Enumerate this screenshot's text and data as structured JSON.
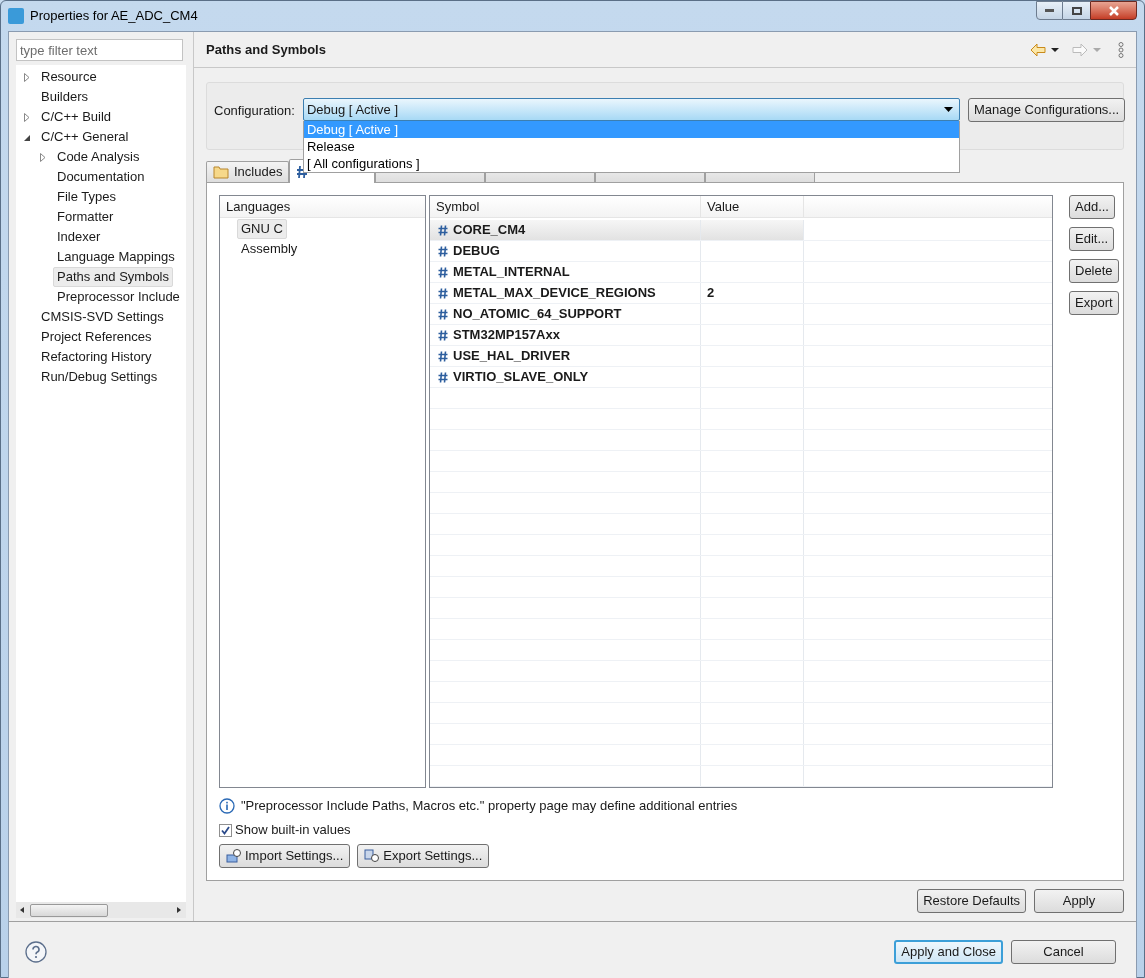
{
  "window": {
    "title": "Properties for AE_ADC_CM4"
  },
  "filter": {
    "placeholder": "type filter text"
  },
  "tree": [
    {
      "label": "Resource",
      "selected": false,
      "expanded": false
    },
    {
      "label": "Builders",
      "selected": false
    },
    {
      "label": "C/C++ Build",
      "selected": false,
      "expanded": false
    },
    {
      "label": "C/C++ General",
      "selected": false,
      "expanded": true,
      "children": [
        {
          "label": "Code Analysis",
          "selected": false,
          "expanded": false
        },
        {
          "label": "Documentation",
          "selected": false
        },
        {
          "label": "File Types",
          "selected": false
        },
        {
          "label": "Formatter",
          "selected": false
        },
        {
          "label": "Indexer",
          "selected": false
        },
        {
          "label": "Language Mappings",
          "selected": false
        },
        {
          "label": "Paths and Symbols",
          "selected": true
        },
        {
          "label": "Preprocessor Include",
          "selected": false
        }
      ]
    },
    {
      "label": "CMSIS-SVD Settings",
      "selected": false
    },
    {
      "label": "Project References",
      "selected": false
    },
    {
      "label": "Refactoring History",
      "selected": false
    },
    {
      "label": "Run/Debug Settings",
      "selected": false
    }
  ],
  "page_title": "Paths and Symbols",
  "configuration": {
    "label": "Configuration:",
    "value": "Debug  [ Active ]",
    "expanded": true,
    "options": [
      {
        "label": "Debug  [ Active ]",
        "selected": true
      },
      {
        "label": "Release",
        "selected": false
      },
      {
        "label": "[ All configurations ]",
        "selected": false
      }
    ],
    "manage_button": "Manage Configurations..."
  },
  "tabs": [
    {
      "label": "Includes",
      "kind": "folder",
      "selected": false
    },
    {
      "kind": "hash",
      "selected": true
    },
    {
      "selected": false
    },
    {
      "selected": false
    },
    {
      "selected": false
    },
    {
      "selected": false
    }
  ],
  "languages": {
    "header": "Languages",
    "items": [
      {
        "label": "GNU C",
        "selected": true
      },
      {
        "label": "Assembly",
        "selected": false
      }
    ]
  },
  "symbols": {
    "columns": [
      "Symbol",
      "Value"
    ],
    "rows": [
      {
        "symbol": "CORE_CM4",
        "value": "",
        "selected": true
      },
      {
        "symbol": "DEBUG",
        "value": "",
        "selected": false
      },
      {
        "symbol": "METAL_INTERNAL",
        "value": "",
        "selected": false
      },
      {
        "symbol": "METAL_MAX_DEVICE_REGIONS",
        "value": "2",
        "selected": false
      },
      {
        "symbol": "NO_ATOMIC_64_SUPPORT",
        "value": "",
        "selected": false
      },
      {
        "symbol": "STM32MP157Axx",
        "value": "",
        "selected": false
      },
      {
        "symbol": "USE_HAL_DRIVER",
        "value": "",
        "selected": false
      },
      {
        "symbol": "VIRTIO_SLAVE_ONLY",
        "value": "",
        "selected": false
      }
    ]
  },
  "side_buttons": [
    "Add...",
    "Edit...",
    "Delete",
    "Export"
  ],
  "info": "\"Preprocessor Include Paths, Macros etc.\" property page may define additional entries",
  "show_builtin": {
    "label": "Show built-in values",
    "checked": true
  },
  "settings_buttons": [
    {
      "label": "Import Settings...",
      "kind": "import"
    },
    {
      "label": "Export Settings...",
      "kind": "export"
    }
  ],
  "page_buttons": [
    "Restore Defaults",
    "Apply"
  ],
  "dialog_buttons": [
    {
      "label": "Apply and Close",
      "default": true
    },
    {
      "label": "Cancel",
      "default": false
    }
  ]
}
